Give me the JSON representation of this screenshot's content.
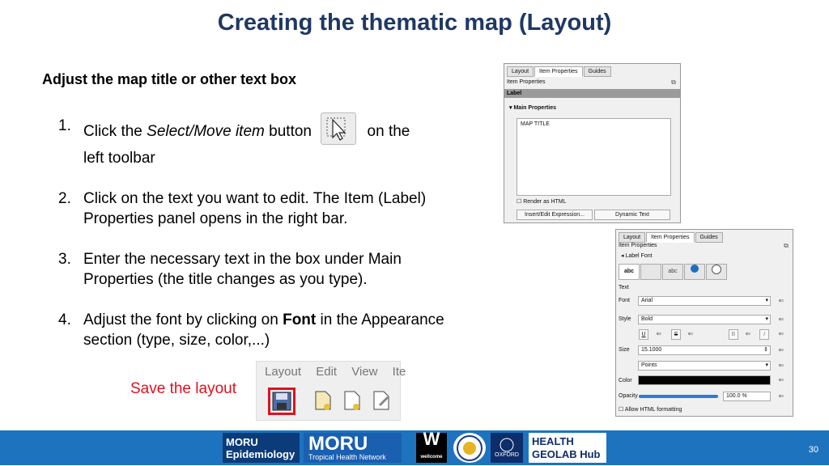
{
  "slide": {
    "title": "Creating the thematic map (Layout)",
    "subtitle": "Adjust the map title or other text box",
    "page_number": "30",
    "save_label": "Save the layout"
  },
  "steps": [
    {
      "num": "1.",
      "pre": "Click the ",
      "em": "Select/Move item",
      "post": " button",
      "tail": " on the",
      "line2": "left toolbar"
    },
    {
      "num": "2.",
      "text": "Click on the text you want to edit. The Item (Label) Properties panel opens in the right bar."
    },
    {
      "num": "3.",
      "text": "Enter the necessary text in the box under Main Properties (the title changes as you type)."
    },
    {
      "num": "4.",
      "pre": "Adjust the font by clicking on ",
      "strong": "Font",
      "post": " in the Appearance section (type, size, color,...)"
    }
  ],
  "toolbar_image": {
    "menus": [
      "Layout",
      "Edit",
      "View",
      "Ite"
    ],
    "icons": [
      "save-icon",
      "page-icon",
      "page-add-icon",
      "page-settings-icon"
    ]
  },
  "panel1": {
    "tabs": [
      "Layout",
      "Item Properties",
      "Guides"
    ],
    "header": "Item Properties",
    "section": "Label",
    "group": "Main Properties",
    "text_value": "MAP TITLE",
    "render_html": "Render as HTML",
    "insert_btn": "Insert/Edit Expression...",
    "dynamic_btn": "Dynamic Text"
  },
  "panel2": {
    "tabs": [
      "Layout",
      "Item Properties",
      "Guides"
    ],
    "header": "Item Properties",
    "group": "Label Font",
    "font_tabs": [
      "abc",
      "",
      "abc",
      "",
      ""
    ],
    "text_heading": "Text",
    "font_label": "Font",
    "font_value": "Arial",
    "style_label": "Style",
    "style_value": "Bold",
    "style_buttons": [
      "U",
      "S",
      "S",
      "B",
      "I",
      "I"
    ],
    "size_label": "Size",
    "size_value": "15.1000",
    "unit_value": "Points",
    "color_label": "Color",
    "color_value": "#000000",
    "opacity_label": "Opacity",
    "opacity_value": "100.0 %",
    "opacity_level": 1.0,
    "allow_html": "Allow HTML formatting"
  },
  "footer": {
    "logos": [
      "MORU Epidemiology",
      "MORU Tropical Health Network",
      "wellcome",
      "Mahidol University",
      "University of Oxford",
      "HEALTH GEOLAB Hub"
    ],
    "logo_texts": {
      "moru_epi_1": "MORU",
      "moru_epi_2": "Epidemiology",
      "moru_big": "MORU",
      "moru_sub": "Tropical Health Network",
      "wellcome": "W",
      "wellcome_sub": "wellcome",
      "oxford": "OXFORD",
      "hgh_1": "HEALTH",
      "hgh_2": "GEOLAB Hub"
    },
    "bg_color": "#1e73be"
  }
}
